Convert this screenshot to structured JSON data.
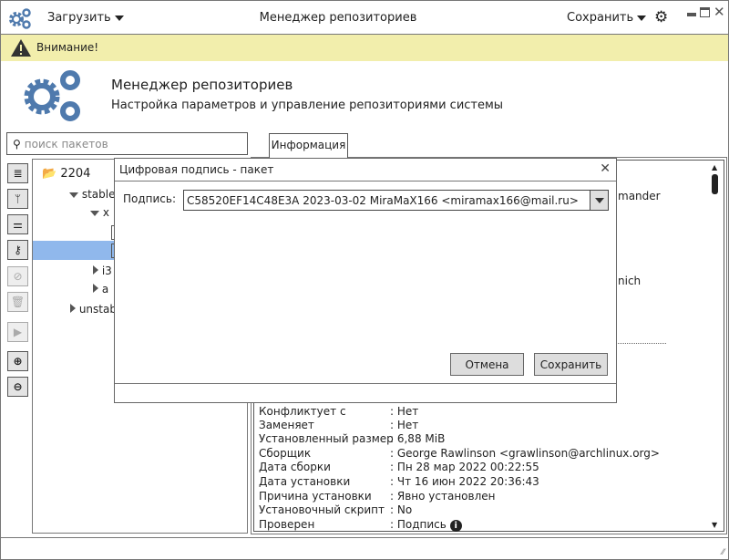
{
  "titlebar": {
    "app_icon": "gears-icon",
    "load_menu": "Загрузить",
    "title": "Менеджер репозиториев",
    "save_menu": "Сохранить",
    "settings_icon": "gear-icon",
    "minimize": "minimize-icon",
    "maximize": "maximize-icon",
    "close": "close-icon"
  },
  "warning": {
    "icon": "warning-icon",
    "text": "Внимание!"
  },
  "header": {
    "title": "Менеджер репозиториев",
    "subtitle": "Настройка параметров и управление репозиториями системы"
  },
  "search": {
    "placeholder": "поиск пакетов",
    "icon": "search-icon"
  },
  "tabs": [
    {
      "label": "Информация",
      "active": true
    }
  ],
  "toolbar": [
    "database-icon",
    "branch-icon",
    "sliders-icon",
    "key-icon",
    "disabled-icon",
    "trash-icon",
    "play-icon",
    "add-icon",
    "remove-icon"
  ],
  "tree": {
    "root": "2204",
    "items": [
      {
        "label": "stable",
        "expanded": true
      },
      {
        "label": "x",
        "expanded": true
      },
      {
        "label": "i3",
        "expanded": false
      },
      {
        "label": "a",
        "expanded": false
      },
      {
        "label": "unstable",
        "expanded": false
      }
    ]
  },
  "info_partial": [
    "mander",
    "nich"
  ],
  "info": [
    {
      "label": "Конфликтует с",
      "value": ": Нет"
    },
    {
      "label": "Заменяет",
      "value": ": Нет"
    },
    {
      "label": "Установленный размер",
      "value": ": 6,88 MiB"
    },
    {
      "label": "Сборщик",
      "value": ": George Rawlinson <grawlinson@archlinux.org>"
    },
    {
      "label": "Дата сборки",
      "value": ": Пн 28 мар 2022 00:22:55"
    },
    {
      "label": "Дата установки",
      "value": ": Чт 16 июн 2022 20:36:43"
    },
    {
      "label": "Причина установки",
      "value": ": Явно установлен"
    },
    {
      "label": "Установочный скрипт",
      "value": ": No"
    },
    {
      "label": "Проверен",
      "value": ": Подпись"
    }
  ],
  "dialog": {
    "title": "Цифровая подпись - пакет",
    "signature_label": "Подпись:",
    "signature_value": "C58520EF14C48E3A 2023-03-02 MiraMaX166 <miramax166@mail.ru>",
    "cancel": "Отмена",
    "save": "Сохранить"
  },
  "colors": {
    "warning_bg": "#f2eeac",
    "selection": "#90b8ec",
    "icon_blue": "#4f7aad"
  }
}
